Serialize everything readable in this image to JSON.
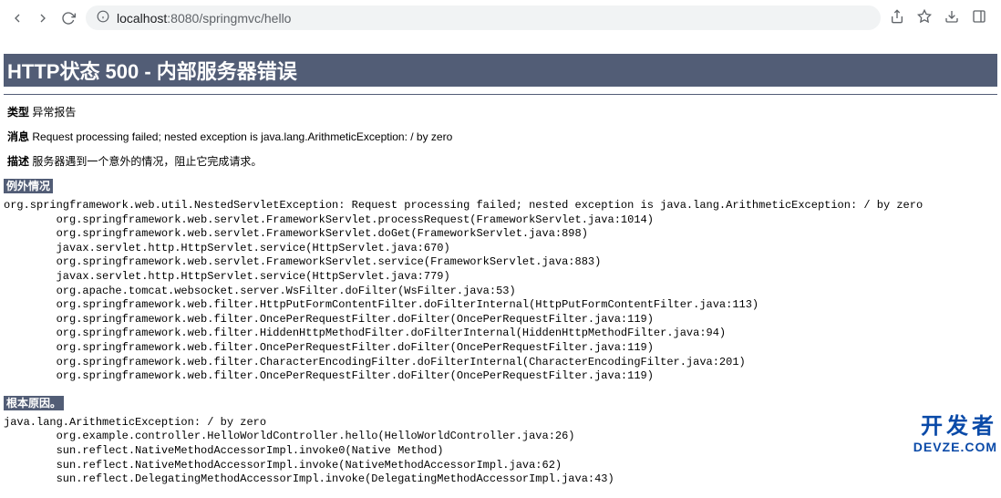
{
  "browser": {
    "url_host": "localhost",
    "url_port": ":8080",
    "url_path": "/springmvc/hello"
  },
  "error": {
    "title": "HTTP状态 500 - 内部服务器错误",
    "type_label": "类型",
    "type_value": "异常报告",
    "message_label": "消息",
    "message_value": "Request processing failed; nested exception is java.lang.ArithmeticException: / by zero",
    "description_label": "描述",
    "description_value": "服务器遇到一个意外的情况，阻止它完成请求。",
    "exception_header": "例外情况",
    "exception_stack": "org.springframework.web.util.NestedServletException: Request processing failed; nested exception is java.lang.ArithmeticException: / by zero\n\torg.springframework.web.servlet.FrameworkServlet.processRequest(FrameworkServlet.java:1014)\n\torg.springframework.web.servlet.FrameworkServlet.doGet(FrameworkServlet.java:898)\n\tjavax.servlet.http.HttpServlet.service(HttpServlet.java:670)\n\torg.springframework.web.servlet.FrameworkServlet.service(FrameworkServlet.java:883)\n\tjavax.servlet.http.HttpServlet.service(HttpServlet.java:779)\n\torg.apache.tomcat.websocket.server.WsFilter.doFilter(WsFilter.java:53)\n\torg.springframework.web.filter.HttpPutFormContentFilter.doFilterInternal(HttpPutFormContentFilter.java:113)\n\torg.springframework.web.filter.OncePerRequestFilter.doFilter(OncePerRequestFilter.java:119)\n\torg.springframework.web.filter.HiddenHttpMethodFilter.doFilterInternal(HiddenHttpMethodFilter.java:94)\n\torg.springframework.web.filter.OncePerRequestFilter.doFilter(OncePerRequestFilter.java:119)\n\torg.springframework.web.filter.CharacterEncodingFilter.doFilterInternal(CharacterEncodingFilter.java:201)\n\torg.springframework.web.filter.OncePerRequestFilter.doFilter(OncePerRequestFilter.java:119)",
    "rootcause_header": "根本原因。",
    "rootcause_stack": "java.lang.ArithmeticException: / by zero\n\torg.example.controller.HelloWorldController.hello(HelloWorldController.java:26)\n\tsun.reflect.NativeMethodAccessorImpl.invoke0(Native Method)\n\tsun.reflect.NativeMethodAccessorImpl.invoke(NativeMethodAccessorImpl.java:62)\n\tsun.reflect.DelegatingMethodAccessorImpl.invoke(DelegatingMethodAccessorImpl.java:43)"
  },
  "watermark": {
    "line1": "开发者",
    "line2": "DEVZE.COM"
  }
}
